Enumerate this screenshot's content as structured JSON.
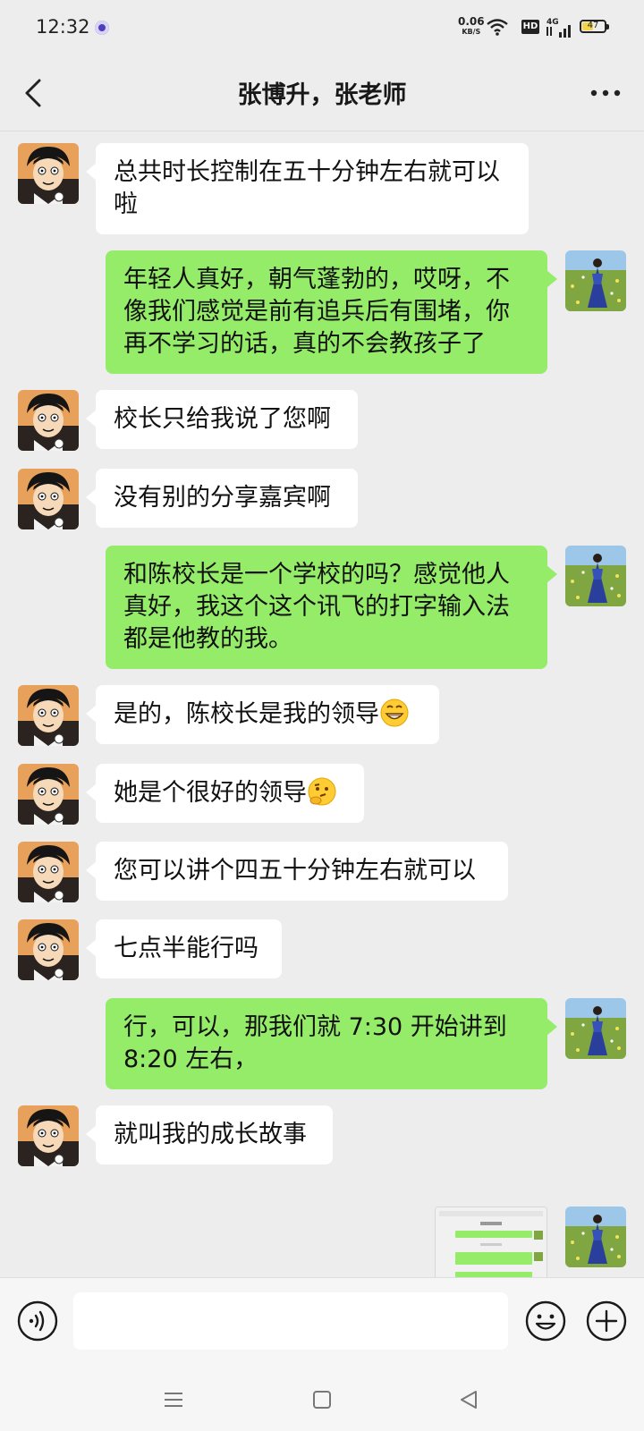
{
  "status_bar": {
    "time": "12:32",
    "net_speed_value": "0.06",
    "net_speed_unit": "KB/S",
    "hd_label": "HD",
    "network_label": "4G",
    "battery_level": "47"
  },
  "header": {
    "title": "张博升，张老师"
  },
  "messages": [
    {
      "side": "left",
      "text": "总共时长控制在五十分钟左右就可以啦"
    },
    {
      "side": "right",
      "text": "年轻人真好，朝气蓬勃的，哎呀，不像我们感觉是前有追兵后有围堵，你再不学习的话，真的不会教孩子了"
    },
    {
      "side": "left",
      "text": "校长只给我说了您啊"
    },
    {
      "side": "left",
      "text": "没有别的分享嘉宾啊"
    },
    {
      "side": "right",
      "text": "和陈校长是一个学校的吗？感觉他人真好，我这个这个讯飞的打字输入法都是他教的我。"
    },
    {
      "side": "left",
      "text": "是的，陈校长是我的领导",
      "emoji": "grinning-face"
    },
    {
      "side": "left",
      "text": "她是个很好的领导",
      "emoji": "thinking-face"
    },
    {
      "side": "left",
      "text": "您可以讲个四五十分钟左右就可以"
    },
    {
      "side": "left",
      "text": "七点半能行吗"
    },
    {
      "side": "right",
      "text": "行，可以，那我们就 7:30 开始讲到 8:20 左右，"
    },
    {
      "side": "left",
      "text": "就叫我的成长故事"
    },
    {
      "side": "right",
      "type": "image-thumbnail"
    }
  ],
  "input_bar": {
    "placeholder": ""
  },
  "colors": {
    "background": "#ededed",
    "sent_bubble": "#95ec69",
    "received_bubble": "#ffffff"
  }
}
